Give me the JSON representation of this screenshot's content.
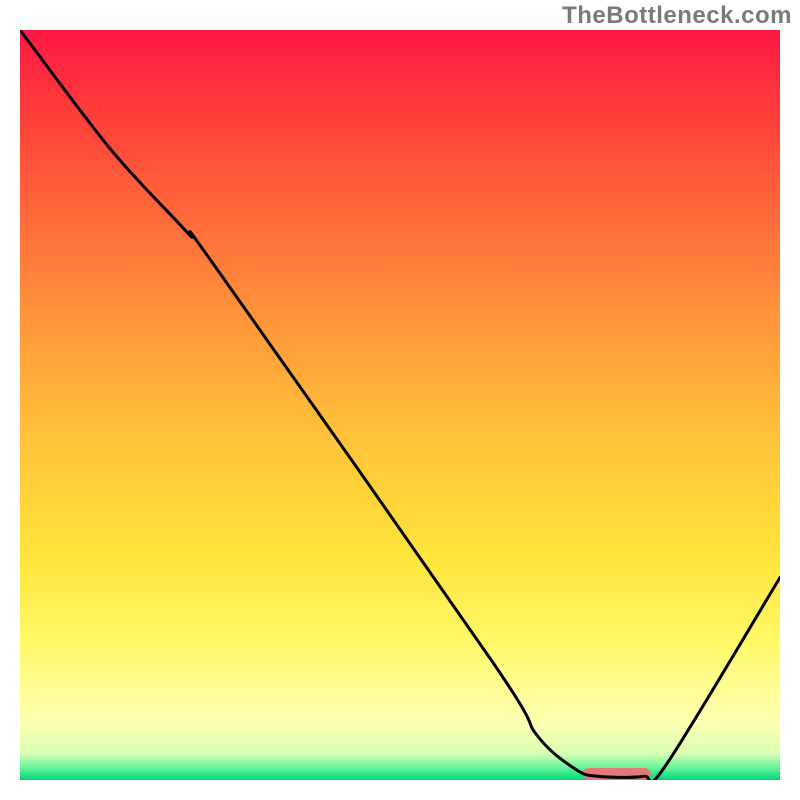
{
  "watermark": "TheBottleneck.com",
  "gradient_stops": [
    {
      "offset": 0.0,
      "color": "#ff1744"
    },
    {
      "offset": 0.1,
      "color": "#ff3a3a"
    },
    {
      "offset": 0.25,
      "color": "#ff6a3a"
    },
    {
      "offset": 0.4,
      "color": "#ff9a3a"
    },
    {
      "offset": 0.55,
      "color": "#ffc43a"
    },
    {
      "offset": 0.7,
      "color": "#ffe43a"
    },
    {
      "offset": 0.82,
      "color": "#fff96a"
    },
    {
      "offset": 0.92,
      "color": "#ffffb0"
    },
    {
      "offset": 0.965,
      "color": "#d8ffb4"
    },
    {
      "offset": 0.985,
      "color": "#5ef29a"
    },
    {
      "offset": 1.0,
      "color": "#00d67a"
    }
  ],
  "chart_data": {
    "type": "line",
    "title": "",
    "xlabel": "",
    "ylabel": "",
    "xlim": [
      0,
      100
    ],
    "ylim": [
      0,
      100
    ],
    "series": [
      {
        "name": "curve",
        "points": [
          {
            "x": 0,
            "y": 100
          },
          {
            "x": 12,
            "y": 84
          },
          {
            "x": 22,
            "y": 73
          },
          {
            "x": 26,
            "y": 68
          },
          {
            "x": 62,
            "y": 16
          },
          {
            "x": 68,
            "y": 6
          },
          {
            "x": 73,
            "y": 1.5
          },
          {
            "x": 76,
            "y": 0.5
          },
          {
            "x": 82,
            "y": 0.5
          },
          {
            "x": 85,
            "y": 2
          },
          {
            "x": 100,
            "y": 27
          }
        ]
      }
    ],
    "marker": {
      "x_start": 74,
      "x_end": 83,
      "y": 0.8,
      "height": 1.6,
      "color": "#e27a7a"
    }
  }
}
